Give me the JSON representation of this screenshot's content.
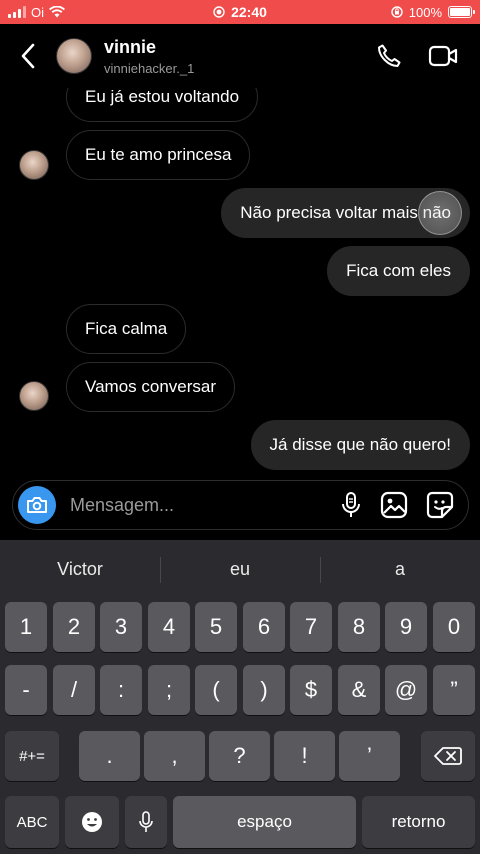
{
  "status_bar": {
    "carrier": "Oi",
    "time": "22:40",
    "battery_percent": "100%",
    "battery_level": 1.0,
    "background_color": "#f04c4c"
  },
  "header": {
    "name": "vinnie",
    "username": "vinniehacker._1",
    "icons": [
      "back-icon",
      "phone-icon",
      "video-camera-icon"
    ]
  },
  "messages": [
    {
      "direction": "in",
      "text": "Eu já estou voltando"
    },
    {
      "direction": "in",
      "text": "Eu te amo princesa"
    },
    {
      "direction": "out",
      "text": "Não precisa voltar mais não"
    },
    {
      "direction": "out",
      "text": "Fica com eles"
    },
    {
      "direction": "in",
      "text": "Fica calma"
    },
    {
      "direction": "in",
      "text": "Vamos conversar"
    },
    {
      "direction": "out",
      "text": "Já disse que não quero!"
    }
  ],
  "composer": {
    "placeholder": "Mensagem...",
    "icons": [
      "camera-icon",
      "microphone-icon",
      "gallery-icon",
      "sticker-icon"
    ],
    "camera_color": "#3a97f0"
  },
  "keyboard": {
    "suggestions": [
      "Victor",
      "eu",
      "a"
    ],
    "row1": [
      "1",
      "2",
      "3",
      "4",
      "5",
      "6",
      "7",
      "8",
      "9",
      "0"
    ],
    "row2": [
      "-",
      "/",
      ":",
      ";",
      "(",
      ")",
      "$",
      "&",
      "@",
      "”"
    ],
    "row3": {
      "symbols": "#+=",
      "keys": [
        ".",
        ",",
        "?",
        "!",
        "’"
      ],
      "delete": "backspace-icon"
    },
    "row4": {
      "abc": "ABC",
      "emoji": "emoji-icon",
      "dictation": "microphone-icon",
      "space": "espaço",
      "return": "retorno"
    }
  }
}
